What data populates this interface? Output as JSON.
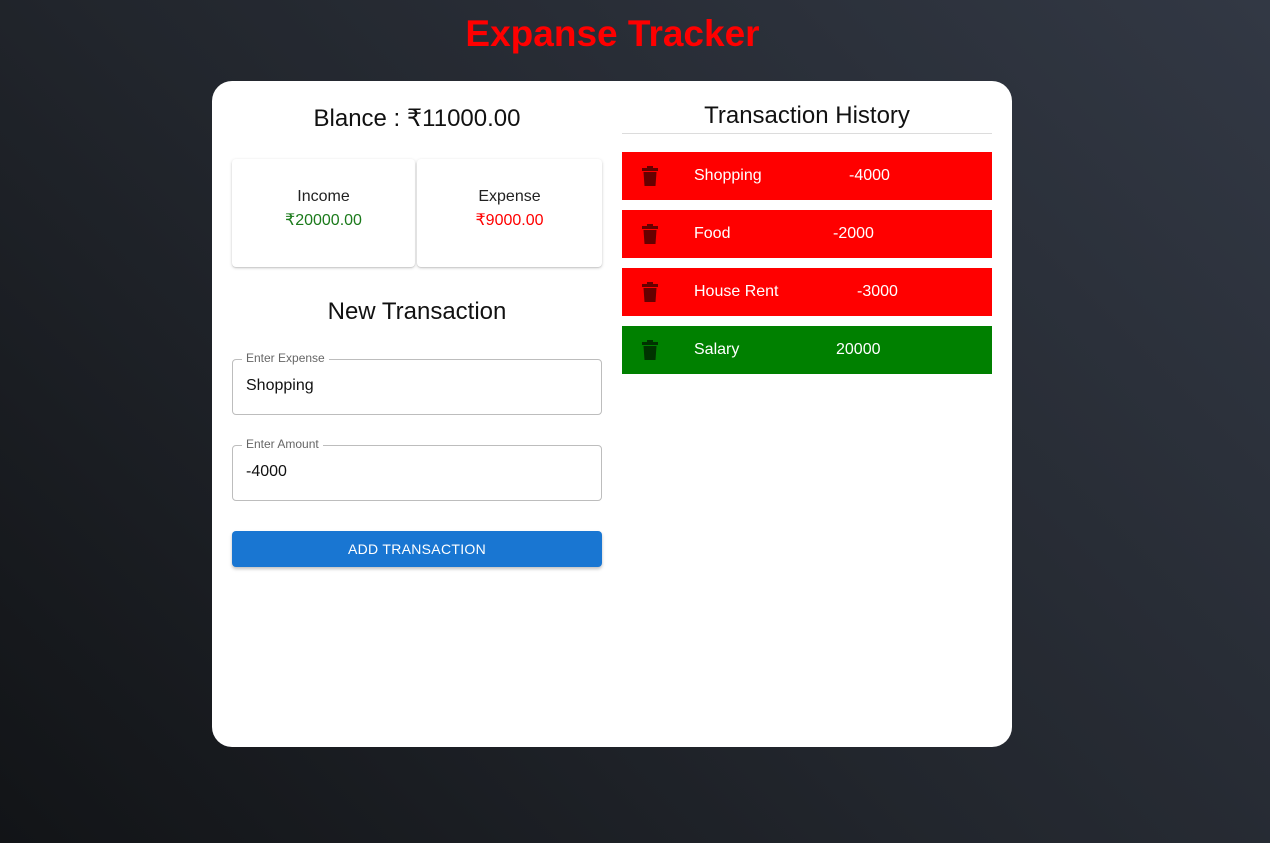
{
  "header": {
    "title": "Expanse Tracker",
    "title_color": "#ff0000"
  },
  "balance": {
    "text": "Blance : ₹11000.00"
  },
  "summary": {
    "income_label": "Income",
    "income_value": "₹20000.00",
    "income_color": "#1b7a1b",
    "expense_label": "Expense",
    "expense_value": "₹9000.00",
    "expense_color": "#ff0000"
  },
  "form": {
    "heading": "New Transaction",
    "expense_label": "Enter Expense",
    "expense_value": "Shopping",
    "amount_label": "Enter Amount",
    "amount_value": "-4000",
    "submit_label": "ADD TRANSACTION",
    "button_color": "#1976d2"
  },
  "history": {
    "heading": "Transaction History",
    "delete_icon": "trash-icon",
    "expense_row_color": "#ff0000",
    "income_row_color": "#008000",
    "items": [
      {
        "name": "Shopping",
        "amount": "-4000",
        "type": "expense"
      },
      {
        "name": "Food",
        "amount": "-2000",
        "type": "expense"
      },
      {
        "name": "House Rent",
        "amount": "-3000",
        "type": "expense"
      },
      {
        "name": "Salary",
        "amount": "20000",
        "type": "income"
      }
    ]
  }
}
